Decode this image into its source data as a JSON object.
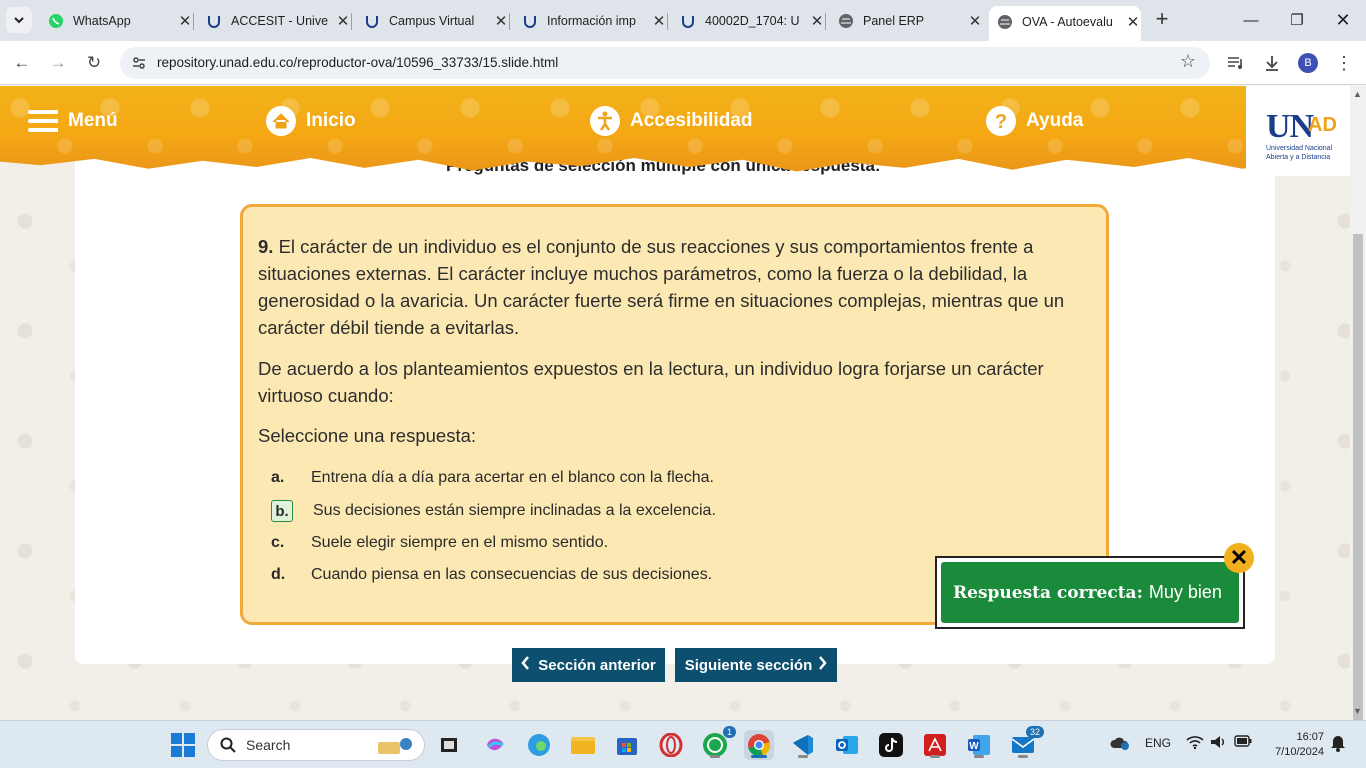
{
  "browser": {
    "tabs": [
      {
        "title": "WhatsApp",
        "active": false
      },
      {
        "title": "ACCESIT - Unive",
        "active": false
      },
      {
        "title": "Campus Virtual",
        "active": false
      },
      {
        "title": "Información imp",
        "active": false
      },
      {
        "title": "40002D_1704: U",
        "active": false
      },
      {
        "title": "Panel ERP",
        "active": false
      },
      {
        "title": "OVA - Autoevalu",
        "active": true
      }
    ],
    "url": "repository.unad.edu.co/reproductor-ova/10596_33733/15.slide.html",
    "profile_initial": "B"
  },
  "banner": {
    "menu_label": "Menú",
    "home_label": "Inicio",
    "accessibility_label": "Accesibilidad",
    "help_label": "Ayuda",
    "logo_text": "UN",
    "logo_ad": "AD",
    "logo_sub1": "Universidad Nacional",
    "logo_sub2": "Abierta y a Distancia"
  },
  "section_title": "Preguntas de selección múltiple con única respuesta:",
  "question": {
    "number": "9.",
    "text": "El carácter de un individuo es el conjunto de sus reacciones y sus comportamientos frente a situaciones externas. El carácter incluye muchos parámetros, como la fuerza o la debilidad, la generosidad o la avaricia. Un carácter fuerte será firme en situaciones complejas, mientras que un carácter débil tiende a evitarlas.",
    "prompt": "De acuerdo a los planteamientos expuestos en la lectura, un individuo logra forjarse un carácter virtuoso cuando:",
    "instruction": "Seleccione una respuesta:",
    "options": [
      {
        "letter": "a.",
        "text": "Entrena día a día para acertar en el blanco con la flecha."
      },
      {
        "letter": "b.",
        "text": "Sus decisiones están siempre inclinadas a la excelencia.",
        "selected": true
      },
      {
        "letter": "c.",
        "text": "Suele elegir siempre en el mismo sentido."
      },
      {
        "letter": "d.",
        "text": "Cuando piensa en las consecuencias de sus decisiones."
      }
    ]
  },
  "nav": {
    "prev_label": "Sección anterior",
    "next_label": "Siguiente sección"
  },
  "feedback": {
    "title": "Respuesta correcta:",
    "message": "Muy bien"
  },
  "taskbar": {
    "search_placeholder": "Search",
    "whatsapp_badge": "1",
    "mail_badge": "32",
    "language": "ENG",
    "time": "16:07",
    "date": "7/10/2024"
  },
  "colors": {
    "banner": "#f4a714",
    "question_bg": "#fce8b3",
    "question_border": "#f1a93a",
    "nav_button": "#0d4f6f",
    "correct": "#1a8b3a"
  }
}
